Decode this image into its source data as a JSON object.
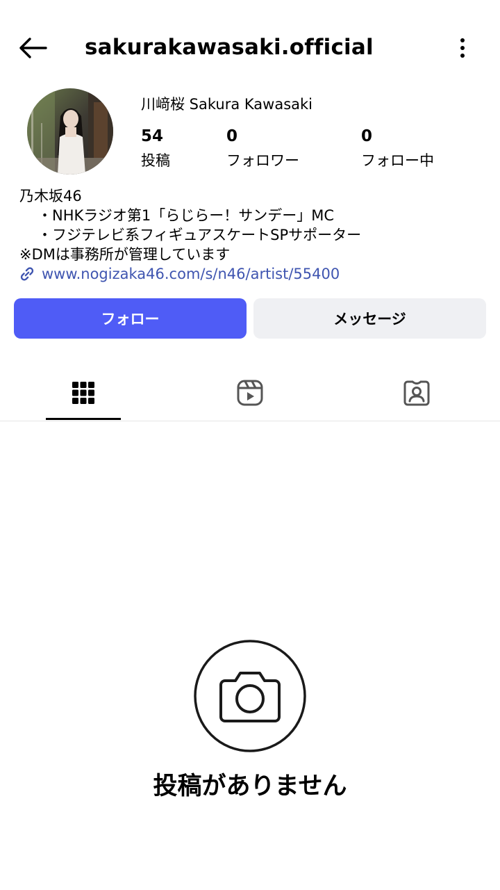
{
  "header": {
    "username": "sakurakawasaki.official",
    "back_icon": "arrow-left-icon",
    "more_icon": "more-vertical-icon"
  },
  "profile": {
    "display_name": "川﨑桜 Sakura Kawasaki",
    "stats": [
      {
        "count": "54",
        "label": "投稿"
      },
      {
        "count": "0",
        "label": "フォロワー"
      },
      {
        "count": "0",
        "label": "フォロー中"
      }
    ],
    "bio": [
      "乃木坂46",
      "・NHKラジオ第1「らじらー！サンデー」MC",
      "・フジテレビ系フィギュアスケートSPサポーター",
      "※DMは事務所が管理しています"
    ],
    "link": "www.nogizaka46.com/s/n46/artist/55400",
    "link_icon": "link-icon"
  },
  "actions": {
    "follow_label": "フォロー",
    "message_label": "メッセージ"
  },
  "tabs": [
    {
      "icon": "grid-icon",
      "active": true
    },
    {
      "icon": "reels-icon",
      "active": false
    },
    {
      "icon": "tagged-icon",
      "active": false
    }
  ],
  "empty_state": {
    "icon": "camera-icon",
    "text": "投稿がありません"
  },
  "colors": {
    "accent": "#4f5cf6",
    "link": "#3f55b0",
    "secondary_button": "#eff0f3"
  }
}
